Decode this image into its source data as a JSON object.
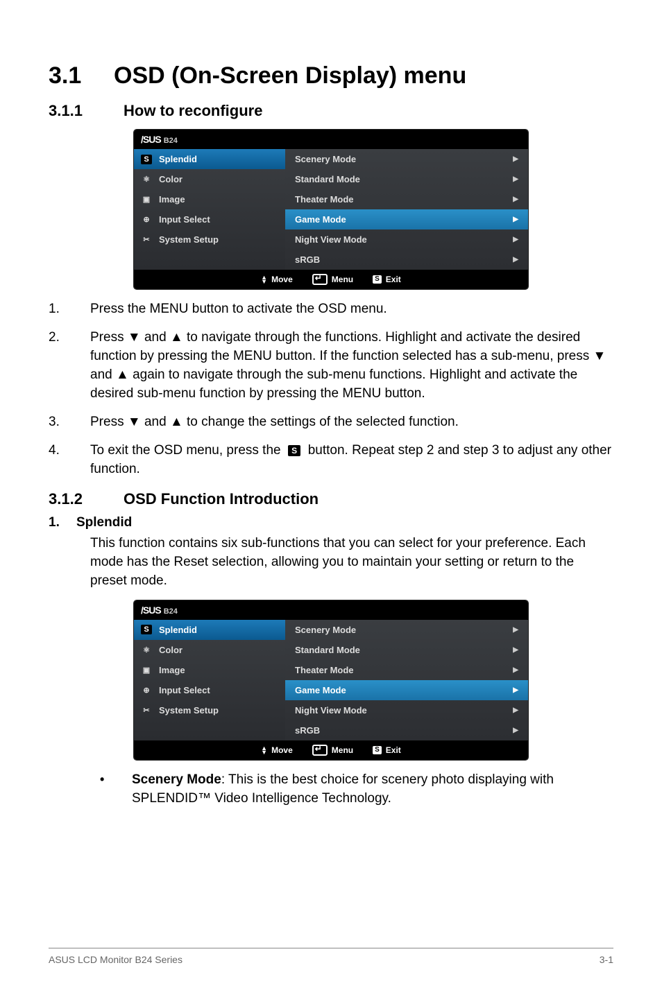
{
  "heading": {
    "num": "3.1",
    "title": "OSD (On-Screen Display) menu"
  },
  "sec311": {
    "num": "3.1.1",
    "title": "How to reconfigure"
  },
  "osd": {
    "brand": "/SUS",
    "model": "B24",
    "side": [
      {
        "icon": "S",
        "label": "Splendid",
        "selected": true
      },
      {
        "icon": "pal",
        "label": "Color"
      },
      {
        "icon": "img",
        "label": "Image"
      },
      {
        "icon": "in",
        "label": "Input Select"
      },
      {
        "icon": "tool",
        "label": "System Setup"
      }
    ],
    "main": [
      {
        "label": "Scenery Mode"
      },
      {
        "label": "Standard Mode"
      },
      {
        "label": "Theater Mode"
      },
      {
        "label": "Game Mode",
        "selected": true
      },
      {
        "label": "Night View Mode"
      },
      {
        "label": "sRGB"
      }
    ],
    "hints": {
      "move": "Move",
      "menu": "Menu",
      "exit": "Exit",
      "exit_icon": "S"
    }
  },
  "steps": {
    "s1": {
      "n": "1.",
      "t": "Press the MENU button to activate the OSD menu."
    },
    "s2": {
      "n": "2.",
      "t_a": "Press ",
      "t_b": " and ",
      "t_c": " to navigate through the functions. Highlight and activate the desired function by pressing the MENU button. If the function selected has a sub-menu, press ",
      "t_d": " and ",
      "t_e": " again to navigate through the sub-menu functions. Highlight and activate the desired sub-menu function by pressing the MENU button.",
      "down": "▼",
      "up": "▲"
    },
    "s3": {
      "n": "3.",
      "t_a": "Press ",
      "t_b": " and ",
      "t_c": " to change the settings of the selected function.",
      "down": "▼",
      "up": "▲"
    },
    "s4": {
      "n": "4.",
      "t_a": "To exit the OSD menu, press the ",
      "t_b": " button. Repeat step 2 and step 3 to adjust any other function.",
      "icon": "S"
    }
  },
  "sec312": {
    "num": "3.1.2",
    "title": "OSD Function Introduction"
  },
  "sub1": {
    "num": "1.",
    "title": "Splendid",
    "para": "This function contains six sub-functions that you can select for your preference. Each mode has the Reset selection, allowing you to maintain your setting or return to the preset mode."
  },
  "bullet_scenery": {
    "bold": "Scenery Mode",
    "rest": ": This is the best choice for scenery photo displaying with SPLENDID™ Video Intelligence Technology."
  },
  "footer": {
    "left": "ASUS LCD Monitor B24 Series",
    "right": "3-1"
  }
}
